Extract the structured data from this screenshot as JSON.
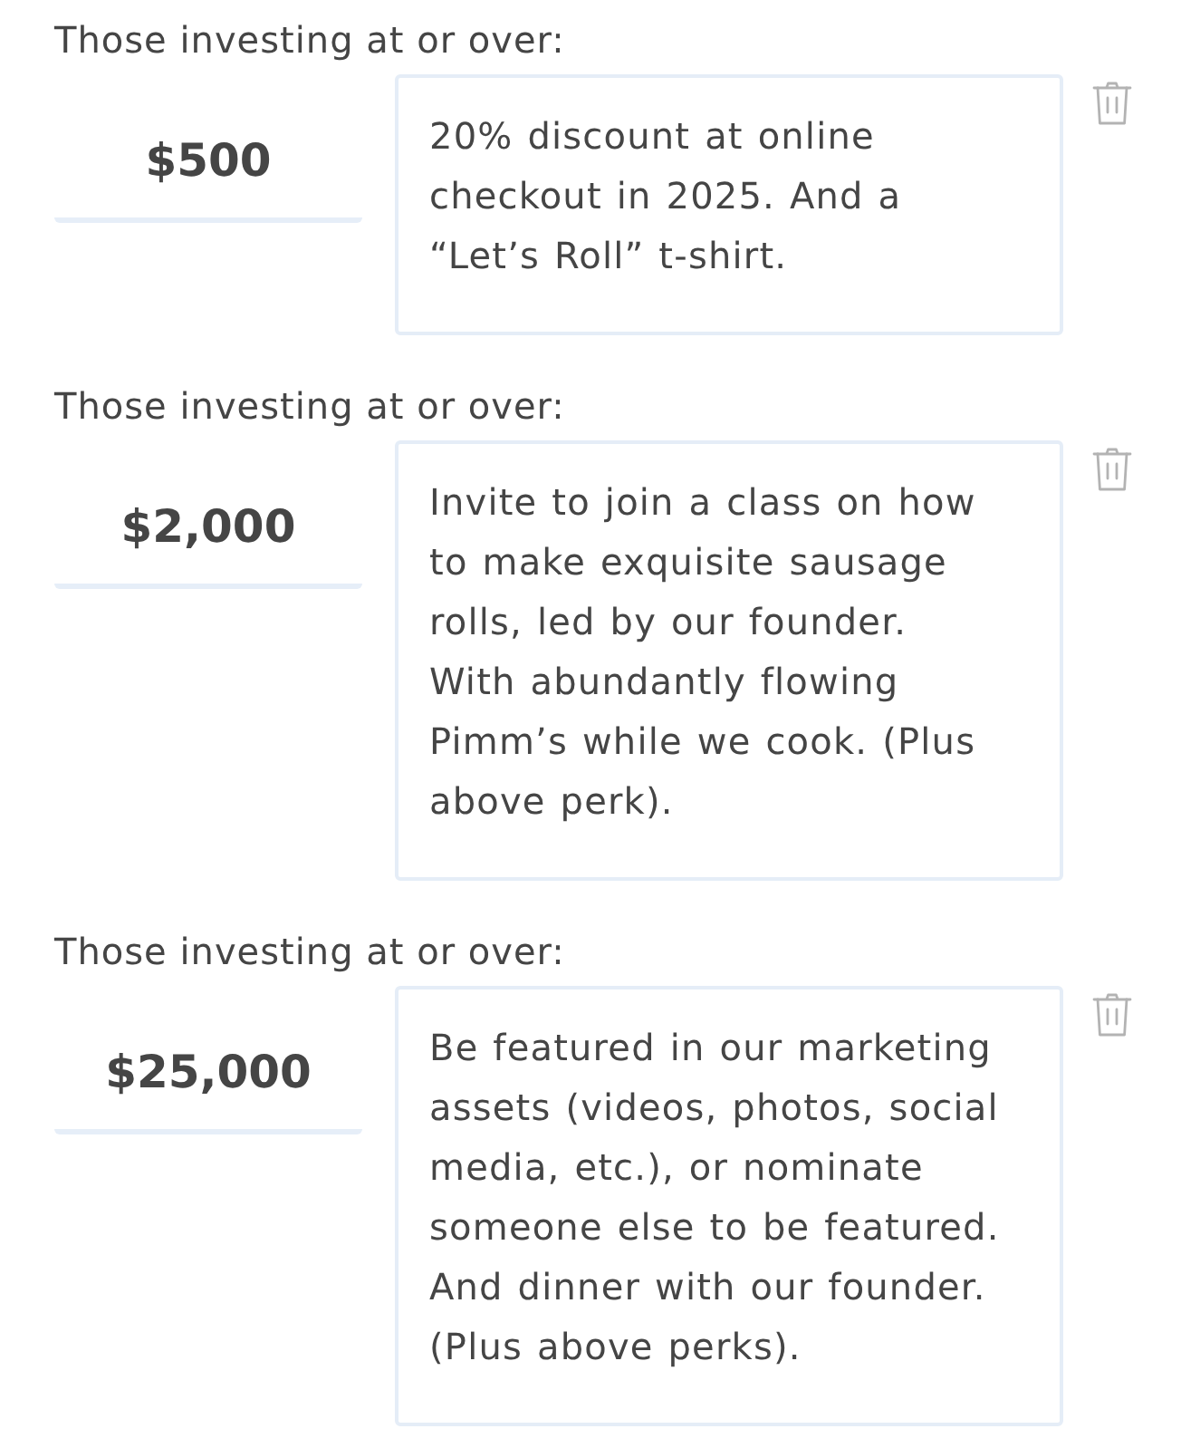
{
  "tiers": [
    {
      "label": "Those investing at or over:",
      "amount": "$500",
      "perk": "20% discount at online checkout in 2025. And a “Let’s Roll” t-shirt."
    },
    {
      "label": "Those investing at or over:",
      "amount": "$2,000",
      "perk": "Invite to join a class on how to make exquisite sausage rolls, led by our founder. With abundantly flowing Pimm’s while we cook. (Plus above perk)."
    },
    {
      "label": "Those investing at or over:",
      "amount": "$25,000",
      "perk": "Be featured in our marketing assets (videos, photos, social media, etc.), or nominate someone else to be featured. And dinner with our founder. (Plus above perks)."
    }
  ]
}
